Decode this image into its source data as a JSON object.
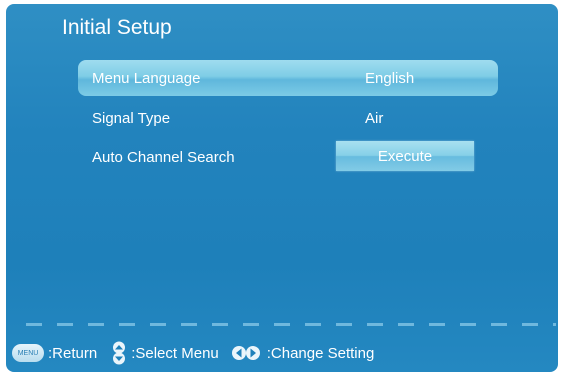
{
  "title": "Initial Setup",
  "menu": {
    "items": [
      {
        "label": "Menu Language",
        "value": "English"
      },
      {
        "label": "Signal Type",
        "value": "Air"
      },
      {
        "label": "Auto Channel Search",
        "button": "Execute"
      }
    ]
  },
  "footer": {
    "menu_key": "MENU",
    "return_label": ":Return",
    "select_label": ":Select Menu",
    "change_label": ":Change Setting"
  },
  "colors": {
    "background": "#2283bd",
    "highlight": "#7fcde6",
    "text": "#ffffff"
  }
}
